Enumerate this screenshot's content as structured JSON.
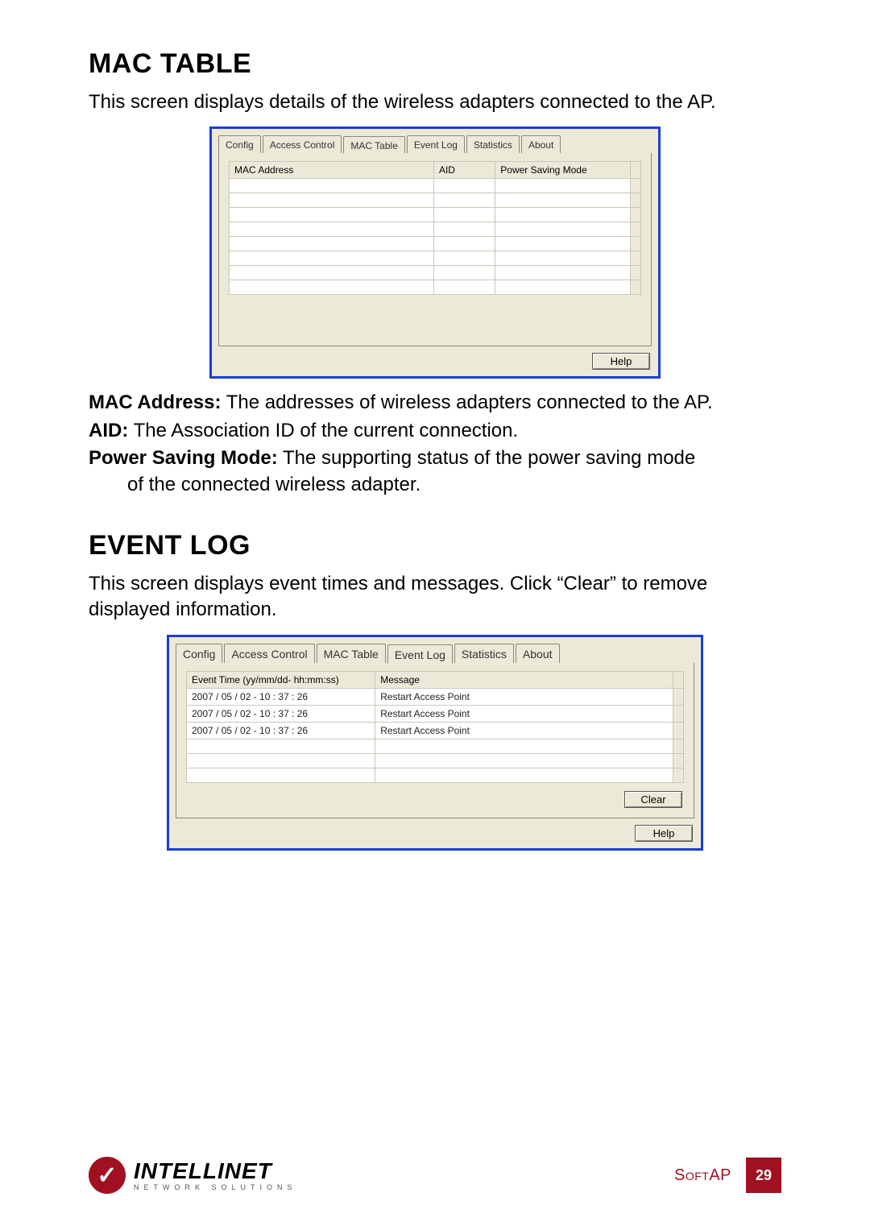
{
  "mac_section": {
    "heading": "MAC TABLE",
    "intro": "This screen displays details of the wireless adapters connected to the AP.",
    "dialog": {
      "tabs": [
        "Config",
        "Access Control",
        "MAC Table",
        "Event Log",
        "Statistics",
        "About"
      ],
      "active_tab": "MAC Table",
      "columns": [
        "MAC Address",
        "AID",
        "Power Saving Mode"
      ],
      "help_btn": "Help"
    },
    "definitions": [
      {
        "label": "MAC Address:",
        "text": " The addresses of wireless adapters connected to the AP."
      },
      {
        "label": "AID:",
        "text": " The Association ID of the current connection."
      },
      {
        "label": "Power Saving Mode:",
        "text": " The supporting status of the power saving mode",
        "cont": "of the connected wireless adapter."
      }
    ]
  },
  "event_section": {
    "heading": "EVENT LOG",
    "intro": "This screen displays event times and messages. Click “Clear” to remove displayed information.",
    "dialog": {
      "tabs": [
        "Config",
        "Access Control",
        "MAC Table",
        "Event Log",
        "Statistics",
        "About"
      ],
      "active_tab": "Event Log",
      "columns": [
        "Event Time (yy/mm/dd- hh:mm:ss)",
        "Message"
      ],
      "rows": [
        {
          "time": "2007 / 05 / 02 - 10 : 37 : 26",
          "msg": "Restart Access Point"
        },
        {
          "time": "2007 / 05 / 02 - 10 : 37 : 26",
          "msg": "Restart Access Point"
        },
        {
          "time": "2007 / 05 / 02 - 10 : 37 : 26",
          "msg": "Restart Access Point"
        }
      ],
      "clear_btn": "Clear",
      "help_btn": "Help"
    }
  },
  "footer": {
    "brand_line1": "INTELLINET",
    "brand_line2": "NETWORK SOLUTIONS",
    "softap": "SoftAP",
    "page": "29"
  }
}
